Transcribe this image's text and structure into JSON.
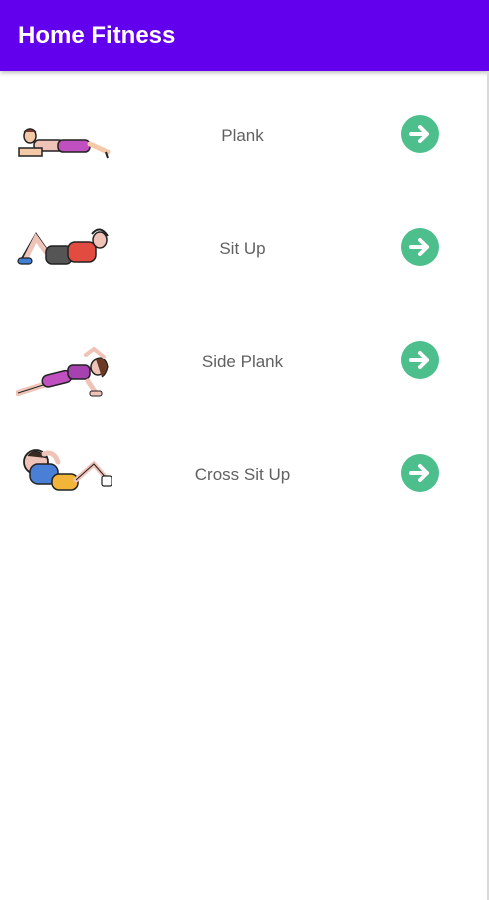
{
  "app": {
    "title": "Home Fitness"
  },
  "exercises": [
    {
      "label": "Plank",
      "icon": "plank-illustration-icon"
    },
    {
      "label": "Sit Up",
      "icon": "sit-up-illustration-icon"
    },
    {
      "label": "Side Plank",
      "icon": "side-plank-illustration-icon"
    },
    {
      "label": "Cross Sit Up",
      "icon": "cross-sit-up-illustration-icon"
    }
  ],
  "colors": {
    "appbar": "#6200ee",
    "accent_button": "#4cbf8c",
    "label_text": "#616161"
  }
}
